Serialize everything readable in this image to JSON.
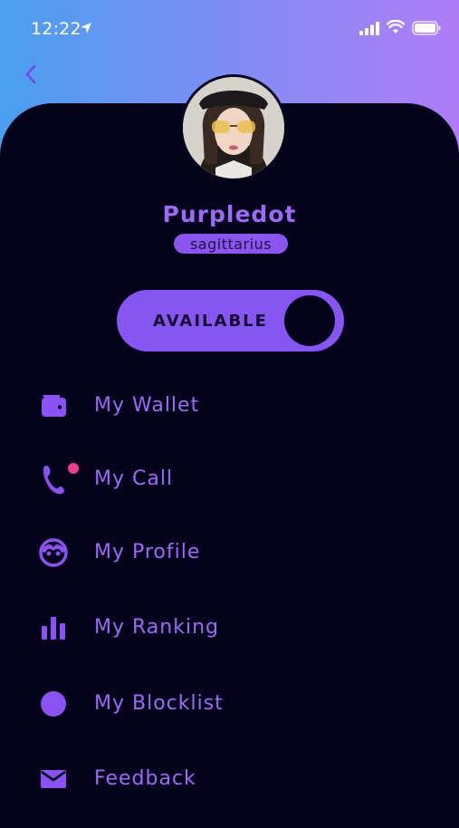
{
  "status_bar": {
    "time": "12:22",
    "icons": [
      "location-arrow-icon",
      "signal-icon",
      "wifi-icon",
      "battery-icon"
    ]
  },
  "colors": {
    "gradient_start": "#4a9ff0",
    "gradient_end": "#b07cf6",
    "background": "#05031c",
    "accent": "#8755f2",
    "notification": "#ec3d8f"
  },
  "header": {
    "back_icon": "chevron-left-icon"
  },
  "profile": {
    "name": "Purpledot",
    "zodiac": "sagittarius"
  },
  "availability": {
    "label": "AVAILABLE",
    "enabled": true
  },
  "menu": {
    "items": [
      {
        "label": "My Wallet",
        "icon": "wallet-icon"
      },
      {
        "label": "My Call",
        "icon": "phone-icon",
        "has_notification": true
      },
      {
        "label": "My Profile",
        "icon": "face-icon"
      },
      {
        "label": "My Ranking",
        "icon": "bar-chart-icon"
      },
      {
        "label": "My Blocklist",
        "icon": "blocklist-icon"
      },
      {
        "label": "Feedback",
        "icon": "envelope-icon"
      }
    ]
  }
}
